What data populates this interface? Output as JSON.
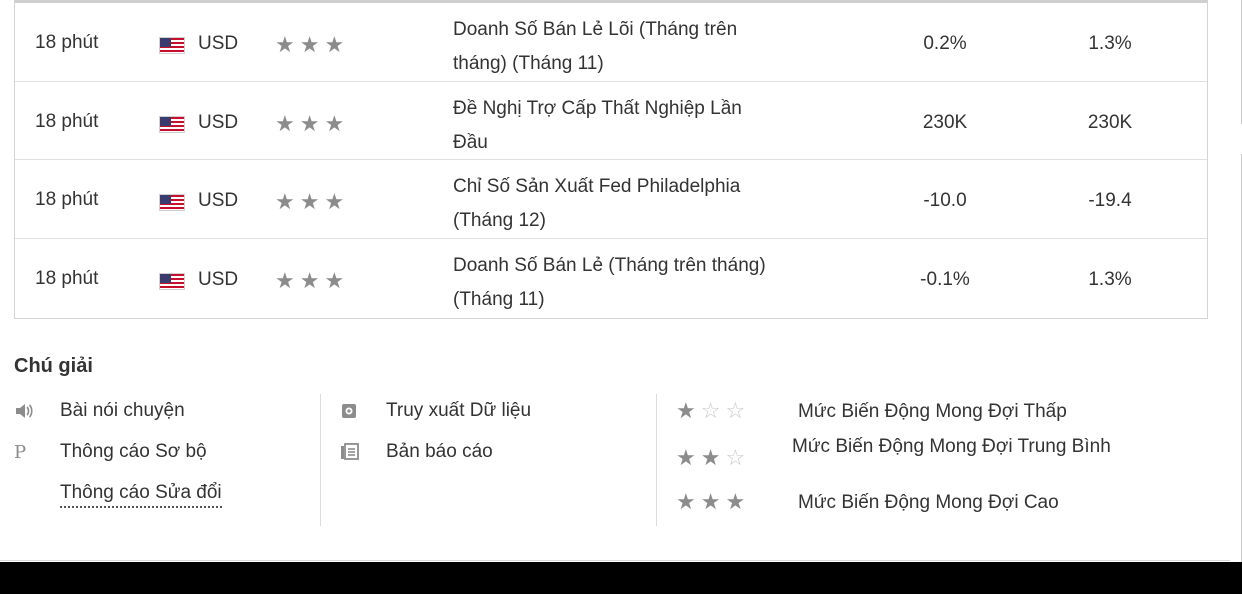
{
  "events": [
    {
      "time": "18 phút",
      "currency": "USD",
      "event": "Doanh Số Bán Lẻ Lõi (Tháng trên tháng) (Tháng 11)",
      "actual": "0.2%",
      "forecast": "1.3%",
      "importance": "★★★"
    },
    {
      "time": "18 phút",
      "currency": "USD",
      "event": "Đề Nghị Trợ Cấp Thất Nghiệp Lần Đầu",
      "actual": "230K",
      "forecast": "230K",
      "importance": "★★★"
    },
    {
      "time": "18 phút",
      "currency": "USD",
      "event": "Chỉ Số Sản Xuất Fed Philadelphia (Tháng 12)",
      "actual": "-10.0",
      "forecast": "-19.4",
      "importance": "★★★"
    },
    {
      "time": "18 phút",
      "currency": "USD",
      "event": "Doanh Số Bán Lẻ (Tháng trên tháng) (Tháng 11)",
      "actual": "-0.1%",
      "forecast": "1.3%",
      "importance": "★★★"
    }
  ],
  "legend": {
    "title": "Chú giải",
    "col1": [
      {
        "icon": "speaker-icon",
        "glyph": "🔈",
        "label": "Bài nói chuyện"
      },
      {
        "icon": "preliminary-p-icon",
        "glyph": "P",
        "label": "Thông cáo Sơ bộ"
      },
      {
        "icon": "",
        "glyph": "",
        "label": "Thông cáo Sửa đổi"
      }
    ],
    "col2": [
      {
        "icon": "data-retrieval-icon",
        "glyph": "▣",
        "label": "Truy xuất Dữ liệu"
      },
      {
        "icon": "report-icon",
        "glyph": "☰",
        "label": "Bản báo cáo"
      }
    ],
    "col3": [
      {
        "on": "★",
        "off": "☆☆",
        "label": "Mức Biến Động Mong Đợi Thấp"
      },
      {
        "on": "★★",
        "off": "☆",
        "label": "Mức Biến Động Mong Đợi Trung Bình"
      },
      {
        "on": "★★★",
        "off": "",
        "label": "Mức Biến Động Mong Đợi Cao"
      }
    ]
  },
  "colors": {
    "star": "#8c8c8c",
    "star_off": "#c8c8c8",
    "flag_red": "#c8102e",
    "flag_blue": "#3c3b6e"
  }
}
